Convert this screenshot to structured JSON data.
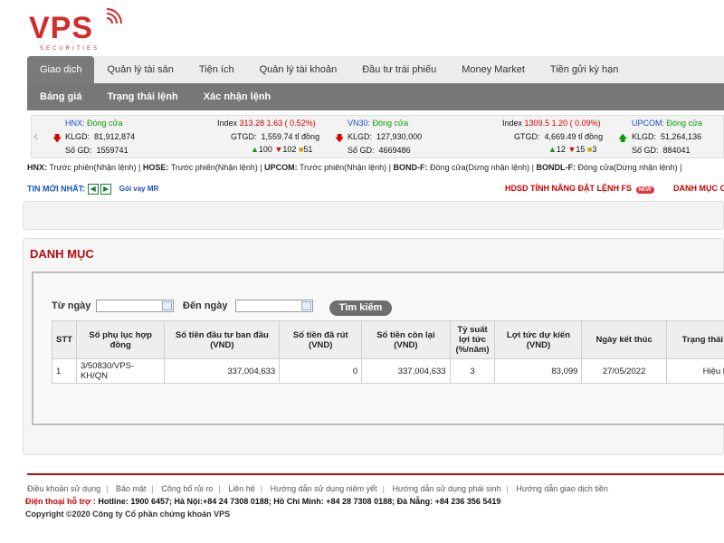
{
  "logo": {
    "text": "VPS",
    "sub": "SECURITIES"
  },
  "menu1": [
    "Giao dịch",
    "Quản lý tài sản",
    "Tiện ích",
    "Quản lý tài khoản",
    "Đầu tư trái phiếu",
    "Money Market",
    "Tiền gửi kỳ hạn"
  ],
  "menu2": [
    "Bảng giá",
    "Trạng thái lệnh",
    "Xác nhận lệnh"
  ],
  "ticker": {
    "hnx": {
      "name": "HNX:",
      "status": "Đóng cửa",
      "index_label": "Index",
      "index": "313.28",
      "change": "1.63 ( 0.52%)",
      "klgd_label": "KLGD:",
      "klgd": "81,912,874",
      "gtgd_label": "GTGD:",
      "gtgd": "1,559.74 tỉ đồng",
      "sogd_label": "Số GD:",
      "sogd": "1559741",
      "up": "100",
      "down": "102",
      "same": "51"
    },
    "vn30": {
      "name": "VN30:",
      "status": "Đóng cửa",
      "index_label": "Index",
      "index": "1309.5",
      "change": "1.20 ( 0.09%)",
      "klgd_label": "KLGD:",
      "klgd": "127,930,000",
      "gtgd_label": "GTGD:",
      "gtgd": "4,669.49 tỉ đồng",
      "sogd_label": "Số GD:",
      "sogd": "4669486",
      "up": "12",
      "down": "15",
      "same": "3"
    },
    "upcom": {
      "name": "UPCOM:",
      "status": "Đóng cửa",
      "klgd_label": "KLGD:",
      "klgd": "51,264,136",
      "sogd_label": "Số GD:",
      "sogd": "884041"
    }
  },
  "market_status": [
    {
      "name": "HNX:",
      "text": "Trước phiên(Nhận lệnh)"
    },
    {
      "name": "HOSE:",
      "text": "Trước phiên(Nhận lệnh)"
    },
    {
      "name": "UPCOM:",
      "text": "Trước phiên(Nhận lệnh)"
    },
    {
      "name": "BOND-F:",
      "text": "Đóng cửa(Dừng nhận lệnh)"
    },
    {
      "name": "BONDL-F:",
      "text": "Đóng cửa(Dừng nhận lệnh)"
    }
  ],
  "news": {
    "label": "TIN MỚI NHẤT:",
    "item": "Gói vay MR",
    "right1": "HDSD TÍNH NĂNG ĐẶT LỆNH FS",
    "badge": "NEW",
    "right2": "DANH MỤC C"
  },
  "panel": {
    "title": "DANH MỤC"
  },
  "filter": {
    "from_label": "Từ ngày",
    "to_label": "Đến ngày",
    "from_value": "",
    "to_value": "",
    "search": "Tìm kiếm"
  },
  "table": {
    "headers": [
      "STT",
      "Số phụ lục hợp đồng",
      "Số tiền đầu tư ban đầu (VND)",
      "Số tiền đã rút (VND)",
      "Số tiền còn lại (VND)",
      "Tỷ suất lợi tức (%/năm)",
      "Lợi tức dự kiến (VND)",
      "Ngày kết thúc",
      "Trạng thái"
    ],
    "rows": [
      [
        "1",
        "3/50830/VPS-KH/QN",
        "337,004,633",
        "0",
        "337,004,633",
        "3",
        "83,099",
        "27/05/2022",
        "Hiệu lực"
      ]
    ]
  },
  "footer": {
    "links": [
      "Điều khoản sử dụng",
      "Bảo mật",
      "Công bố rủi ro",
      "Liên hệ",
      "Hướng dẫn sử dụng niêm yết",
      "Hướng dẫn sử dụng phái sinh",
      "Hướng dẫn giao dịch tiền"
    ],
    "hotline_label": "Điện thoại hỗ trợ :",
    "hotline_text": "Hotline: 1900 6457; Hà Nội:+84 24 7308 0188; Hồ Chí Minh: +84 28 7308 0188; Đà Nẵng: +84 236 356 5419",
    "copyright": "Copyright ©2020 Công ty Cổ phần chứng khoán VPS"
  }
}
